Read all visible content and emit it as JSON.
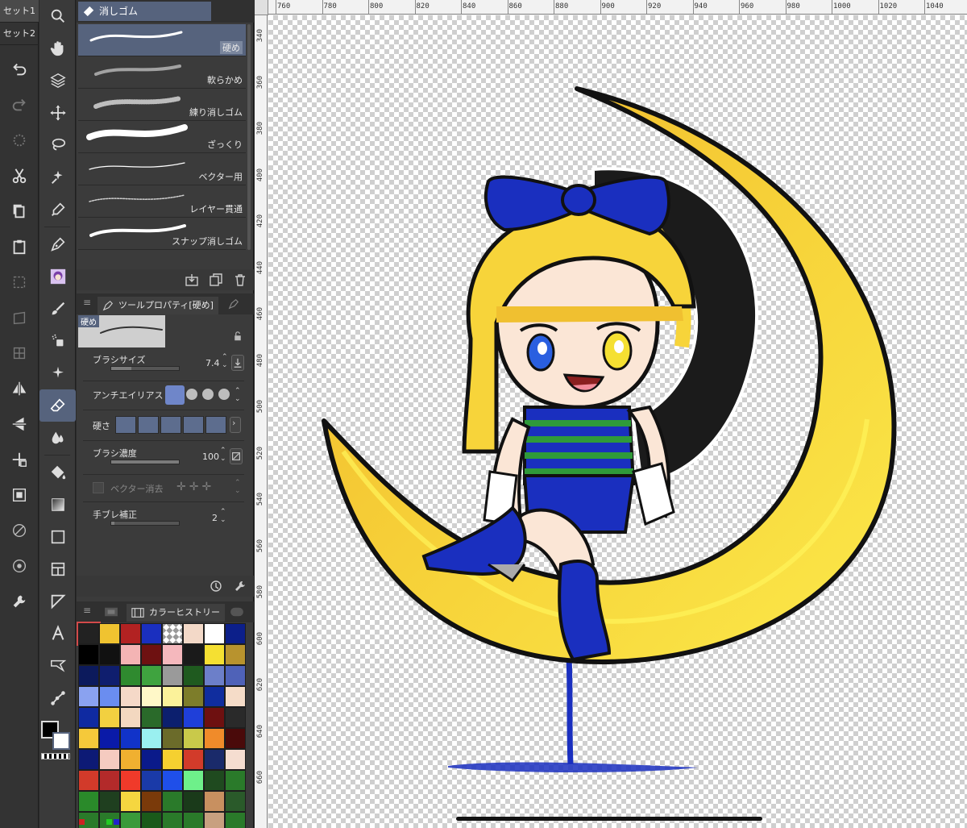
{
  "sets": [
    "セット1",
    "セット2"
  ],
  "subtool_group": {
    "title": "消しゴム"
  },
  "brushes": [
    {
      "label": "硬め",
      "active": true
    },
    {
      "label": "軟らかめ",
      "active": false
    },
    {
      "label": "練り消しゴム",
      "active": false
    },
    {
      "label": "ざっくり",
      "active": false
    },
    {
      "label": "ベクター用",
      "active": false
    },
    {
      "label": "レイヤー貫通",
      "active": false
    },
    {
      "label": "スナップ消しゴム",
      "active": false
    }
  ],
  "tool_property": {
    "tab_title": "ツールプロパティ[硬め]",
    "preview_label": "硬め",
    "brush_size": {
      "label": "ブラシサイズ",
      "value": "7.4",
      "fill": 0.3
    },
    "antialias": {
      "label": "アンチエイリアス"
    },
    "hardness": {
      "label": "硬さ"
    },
    "brush_density": {
      "label": "ブラシ濃度",
      "value": "100",
      "fill": 1.0
    },
    "vector_erase": {
      "label": "ベクター消去"
    },
    "stabilization": {
      "label": "手ブレ補正",
      "value": "2",
      "fill": 0.05
    }
  },
  "color_history": {
    "tab_title": "カラーヒストリー",
    "swatches": [
      "#222222",
      "#f0c330",
      "#b22222",
      "#1a2fbf",
      "checker",
      "#f3d9c8",
      "#ffffff",
      "#0c1f8a",
      "#000000",
      "#111111",
      "#f4b4b4",
      "#6e1111",
      "#f5b8bd",
      "#1a1a1a",
      "#f5e032",
      "#b8932e",
      "#0c1a5c",
      "#0f1e6e",
      "#2f8a2f",
      "#3fa33f",
      "#9a9a9a",
      "#1f5a1f",
      "#6c7fc9",
      "#4f62b8",
      "#8aa2f0",
      "#6a8df0",
      "#f5d9c8",
      "#fff8c8",
      "#fbf29a",
      "#7d7d2a",
      "#102d9e",
      "#f5dcc8",
      "#0f2aa1",
      "#f2d040",
      "#f3d8c0",
      "#2a6a2a",
      "#0c1f6e",
      "#1f3fd9",
      "#6e1010",
      "#2a2a2a",
      "#f5c93a",
      "#0a1aa8",
      "#1133c9",
      "#9af0f0",
      "#6b6b2a",
      "#c9c94a",
      "#f08b2a",
      "#4a0a0a",
      "#0d1a75",
      "#f5cbc0",
      "#f0b030",
      "#0a1a8a",
      "#f5d030",
      "#d23b2a",
      "#1a2a6a",
      "#f5ddd0",
      "#d23a2a",
      "#b32a2a",
      "#f03a2a",
      "#1a3aa8",
      "#1f4fe9",
      "#6ef08a",
      "#1f4a1f",
      "#2a7a2a",
      "#2a8a2a",
      "#1f3f1f",
      "#f5d640",
      "#7a3a0a",
      "#2a7a2a",
      "#1a3a1a",
      "#c89060",
      "#2a5a2a",
      "#2a7a2a",
      "#2a7a2a",
      "#3a9a3a",
      "#1a5a1a",
      "#2a7a2a",
      "#2a7a2a",
      "#c8a080",
      "#2a7a2a"
    ]
  },
  "colors": {
    "main": "#000000",
    "sub": "#ffffff",
    "accent": "#56637d"
  },
  "ruler": {
    "top": [
      "760",
      "780",
      "800",
      "820",
      "840",
      "860",
      "880",
      "900",
      "920",
      "940",
      "960",
      "980",
      "1000",
      "1020",
      "1040"
    ],
    "left": [
      "340",
      "360",
      "380",
      "400",
      "420",
      "440",
      "460",
      "480",
      "500",
      "520",
      "540",
      "560",
      "580",
      "600",
      "620",
      "640",
      "660"
    ]
  },
  "icons": {
    "commands": [
      "undo-icon",
      "redo-icon",
      "loading-icon",
      "cut-icon",
      "copy-icon",
      "paste-icon",
      "transform-icon",
      "free-transform-icon",
      "mesh-transform-icon",
      "flip-horizontal-icon",
      "flip-vertical-icon",
      "move-layer-icon",
      "fill-layer-icon",
      "hide-icon",
      "show-icon",
      "settings-wrench-icon"
    ],
    "tools": [
      "zoom-icon",
      "hand-icon",
      "layer-select-icon",
      "move-icon",
      "lasso-icon",
      "magic-wand-icon",
      "eyedropper-icon",
      "pen-icon",
      "avatar-icon",
      "brush-icon",
      "airbrush-icon",
      "decoration-icon",
      "eraser-icon",
      "blend-icon",
      "fill-icon",
      "gradient-icon",
      "rectangle-icon",
      "frame-icon",
      "ruler-icon",
      "text-icon",
      "balloon-icon",
      "correction-icon"
    ]
  }
}
